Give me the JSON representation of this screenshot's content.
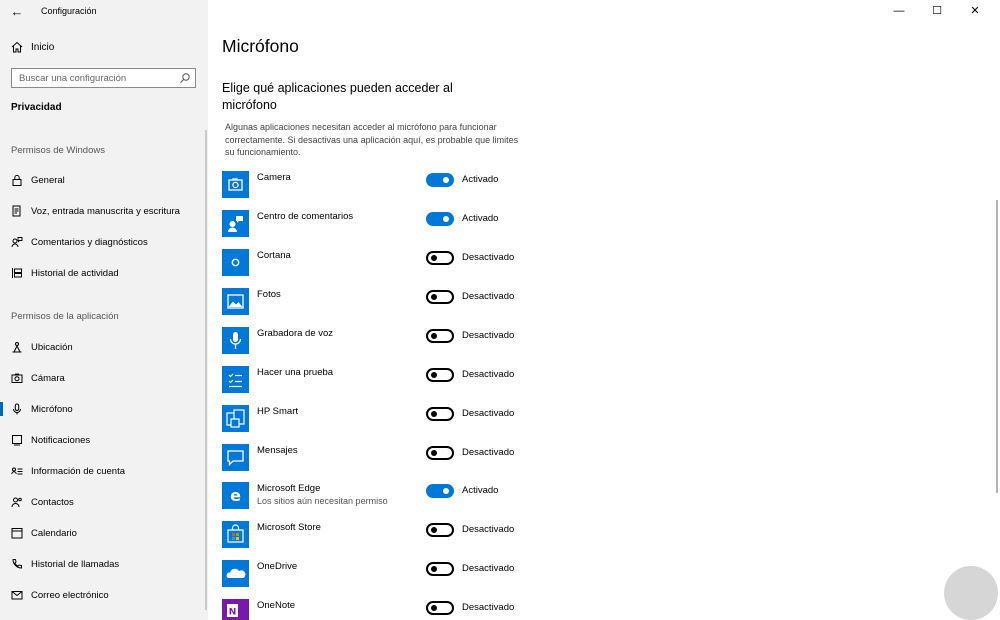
{
  "window": {
    "app_title": "Configuración",
    "minimize_glyph": "—",
    "maximize_glyph": "☐",
    "close_glyph": "✕",
    "back_glyph": "←"
  },
  "sidebar": {
    "home_label": "Inicio",
    "search_placeholder": "Buscar una configuración",
    "section_title": "Privacidad",
    "windows_group": "Permisos de Windows",
    "windows_items": [
      {
        "label": "General",
        "icon": "lock-icon"
      },
      {
        "label": "Voz, entrada manuscrita y escritura",
        "icon": "document-pen-icon"
      },
      {
        "label": "Comentarios y diagnósticos",
        "icon": "person-feedback-icon"
      },
      {
        "label": "Historial de actividad",
        "icon": "timeline-icon"
      }
    ],
    "app_group": "Permisos de la aplicación",
    "app_items": [
      {
        "label": "Ubicación",
        "icon": "location-icon"
      },
      {
        "label": "Cámara",
        "icon": "camera-icon"
      },
      {
        "label": "Micrófono",
        "icon": "microphone-icon",
        "selected": true
      },
      {
        "label": "Notificaciones",
        "icon": "notification-icon"
      },
      {
        "label": "Información de cuenta",
        "icon": "account-info-icon"
      },
      {
        "label": "Contactos",
        "icon": "contacts-icon"
      },
      {
        "label": "Calendario",
        "icon": "calendar-icon"
      },
      {
        "label": "Historial de llamadas",
        "icon": "phone-icon"
      },
      {
        "label": "Correo electrónico",
        "icon": "mail-icon"
      }
    ]
  },
  "main": {
    "title": "Micrófono",
    "subheading": "Elige qué aplicaciones pueden acceder al micrófono",
    "description": "Algunas aplicaciones necesitan acceder al micrófono para funcionar correctamente. Si desactivas una aplicación aquí, es probable que limites su funcionamiento.",
    "apps": [
      {
        "name": "Camera",
        "state": "on",
        "state_label": "Activado",
        "icon": "camera-app-icon",
        "tile_color": "#0078d7"
      },
      {
        "name": "Centro de comentarios",
        "state": "on",
        "state_label": "Activado",
        "icon": "feedback-hub-icon",
        "tile_color": "#0078d7"
      },
      {
        "name": "Cortana",
        "state": "off",
        "state_label": "Desactivado",
        "icon": "cortana-icon",
        "tile_color": "#0078d7"
      },
      {
        "name": "Fotos",
        "state": "off",
        "state_label": "Desactivado",
        "icon": "photos-icon",
        "tile_color": "#0078d7"
      },
      {
        "name": "Grabadora de voz",
        "state": "off",
        "state_label": "Desactivado",
        "icon": "voice-recorder-icon",
        "tile_color": "#0078d7"
      },
      {
        "name": "Hacer una prueba",
        "state": "off",
        "state_label": "Desactivado",
        "icon": "test-checklist-icon",
        "tile_color": "#0078d7"
      },
      {
        "name": "HP Smart",
        "state": "off",
        "state_label": "Desactivado",
        "icon": "hp-smart-icon",
        "tile_color": "#0078d7"
      },
      {
        "name": "Mensajes",
        "state": "off",
        "state_label": "Desactivado",
        "icon": "messages-icon",
        "tile_color": "#0078d7"
      },
      {
        "name": "Microsoft Edge",
        "subtitle": "Los sitios aún necesitan permiso",
        "state": "on",
        "state_label": "Activado",
        "icon": "edge-icon",
        "tile_color": "#0078d7"
      },
      {
        "name": "Microsoft Store",
        "state": "off",
        "state_label": "Desactivado",
        "icon": "store-icon",
        "tile_color": "#0078d7"
      },
      {
        "name": "OneDrive",
        "state": "off",
        "state_label": "Desactivado",
        "icon": "onedrive-icon",
        "tile_color": "#0078d7"
      },
      {
        "name": "OneNote",
        "state": "off",
        "state_label": "Desactivado",
        "icon": "onenote-icon",
        "tile_color": "#0078d7"
      }
    ]
  }
}
